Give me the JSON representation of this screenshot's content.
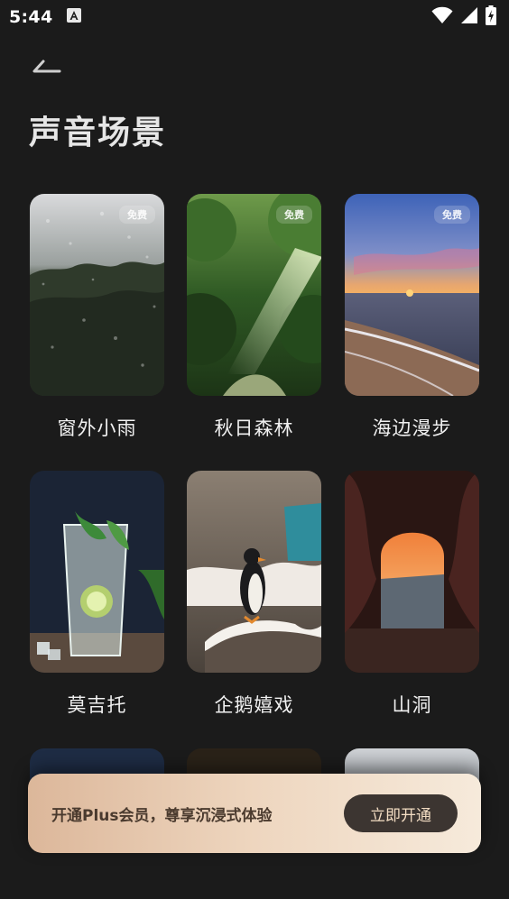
{
  "status": {
    "time": "5:44"
  },
  "page": {
    "title": "声音场景"
  },
  "cards": [
    {
      "label": "窗外小雨",
      "badge": "免费"
    },
    {
      "label": "秋日森林",
      "badge": "免费"
    },
    {
      "label": "海边漫步",
      "badge": "免费"
    },
    {
      "label": "莫吉托"
    },
    {
      "label": "企鹅嬉戏"
    },
    {
      "label": "山洞"
    }
  ],
  "promo": {
    "text": "开通Plus会员，尊享沉浸式体验",
    "button": "立即开通"
  }
}
